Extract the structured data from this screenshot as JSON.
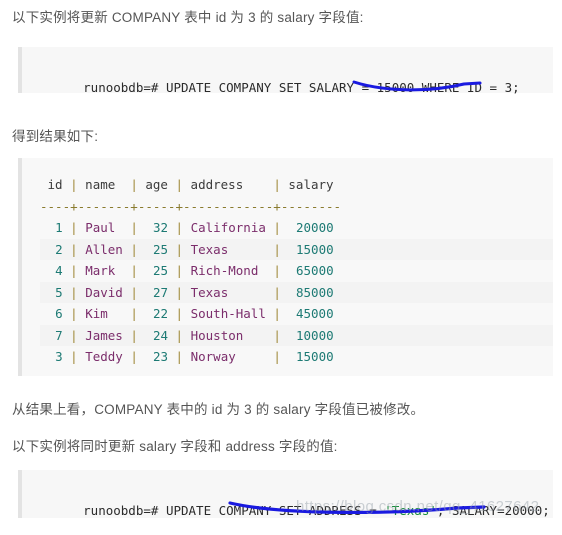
{
  "paragraphs": {
    "intro_update_salary": "以下实例将更新 COMPANY 表中 id 为 3 的 salary 字段值:",
    "result_label": "得到结果如下:",
    "conclusion": "从结果上看，COMPANY 表中的 id 为 3 的 salary 字段值已被修改。",
    "intro_update_both": "以下实例将同时更新 salary 字段和 address 字段的值:"
  },
  "code_block_1": {
    "prompt": "runoobdb=# ",
    "statement": "UPDATE COMPANY SET SALARY = 15000 WHERE ID = 3;",
    "full_line": "runoobdb=# UPDATE COMPANY SET SALARY = 15000 WHERE ID = 3;"
  },
  "code_block_2": {
    "prompt": "runoobdb=# ",
    "statement_before_string": "UPDATE COMPANY SET ADDRESS = ",
    "string_literal": "'Texas'",
    "statement_after_string": ", SALARY=20000;",
    "full_line": "runoobdb=# UPDATE COMPANY SET ADDRESS = 'Texas', SALARY=20000;"
  },
  "result_table": {
    "header": " id | name  | age | address    | salary",
    "separator": "----+-------+-----+------------+--------",
    "columns": [
      "id",
      "name",
      "age",
      "address",
      "salary"
    ],
    "rows": [
      {
        "id": "1",
        "name": "Paul",
        "age": "32",
        "address": "California",
        "salary": "20000"
      },
      {
        "id": "2",
        "name": "Allen",
        "age": "25",
        "address": "Texas",
        "salary": "15000"
      },
      {
        "id": "4",
        "name": "Mark",
        "age": "25",
        "address": "Rich-Mond",
        "salary": "65000"
      },
      {
        "id": "5",
        "name": "David",
        "age": "27",
        "address": "Texas",
        "salary": "85000"
      },
      {
        "id": "6",
        "name": "Kim",
        "age": "22",
        "address": "South-Hall",
        "salary": "45000"
      },
      {
        "id": "7",
        "name": "James",
        "age": "24",
        "address": "Houston",
        "salary": "10000"
      },
      {
        "id": "3",
        "name": "Teddy",
        "age": "23",
        "address": "Norway",
        "salary": "15000"
      }
    ],
    "row_lines": [
      "  1 | Paul  |  32 | California |  20000",
      "  2 | Allen |  25 | Texas      |  15000",
      "  4 | Mark  |  25 | Rich-Mond  |  65000",
      "  5 | David |  27 | Texas      |  85000",
      "  6 | Kim   |  22 | South-Hall |  45000",
      "  7 | James |  24 | Houston    |  10000",
      "  3 | Teddy |  23 | Norway     |  15000"
    ]
  },
  "annotations": {
    "underline_1_target": "WHERE ID = 3;",
    "underline_2_target": "SET ADDRESS = 'Texas'",
    "ink_color": "#1a1ae0"
  },
  "watermark": {
    "text": "https://blog.csdn.net/qq_41627642"
  },
  "colors": {
    "code_bg": "#f7f7f7",
    "code_border": "#e3e3e3",
    "text": "#555555",
    "number": "#1d7a74",
    "string": "#7b2d6b",
    "separator": "#8a7b2e",
    "pipe": "#a08a3a"
  }
}
